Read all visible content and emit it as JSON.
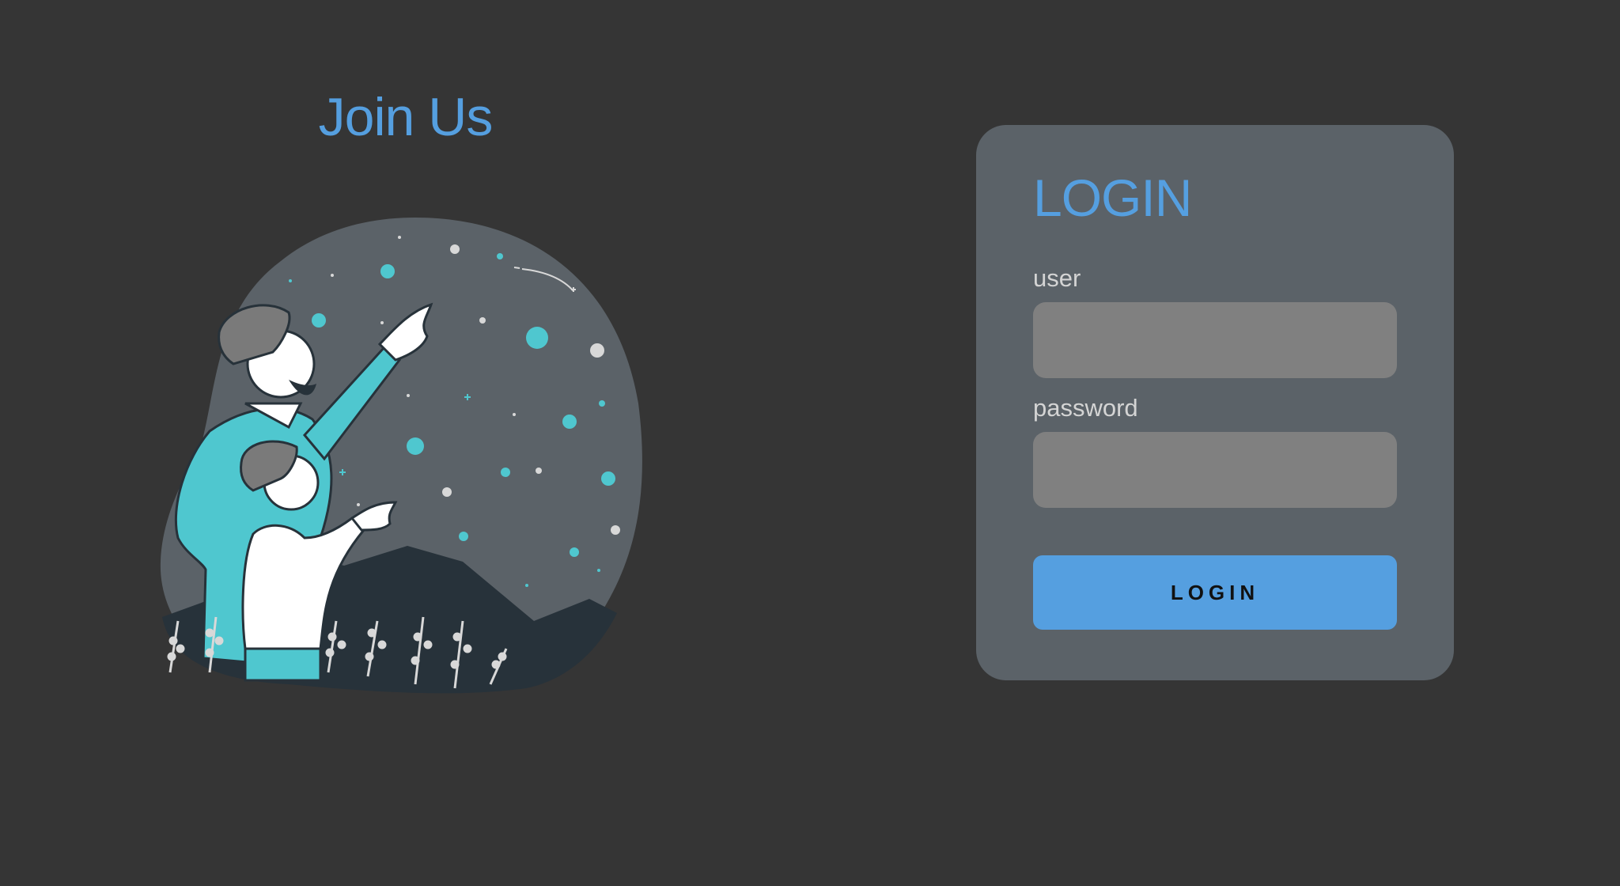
{
  "hero": {
    "title": "Join Us"
  },
  "login": {
    "title": "LOGIN",
    "user_label": "user",
    "user_value": "",
    "password_label": "password",
    "password_value": "",
    "submit_label": "LOGIN"
  },
  "colors": {
    "page_background": "#353535",
    "card_background": "#5b6268",
    "accent": "#559fe0",
    "input_background": "#808080",
    "illustration_teal": "#4fc7cf",
    "illustration_dark": "#27323a"
  }
}
